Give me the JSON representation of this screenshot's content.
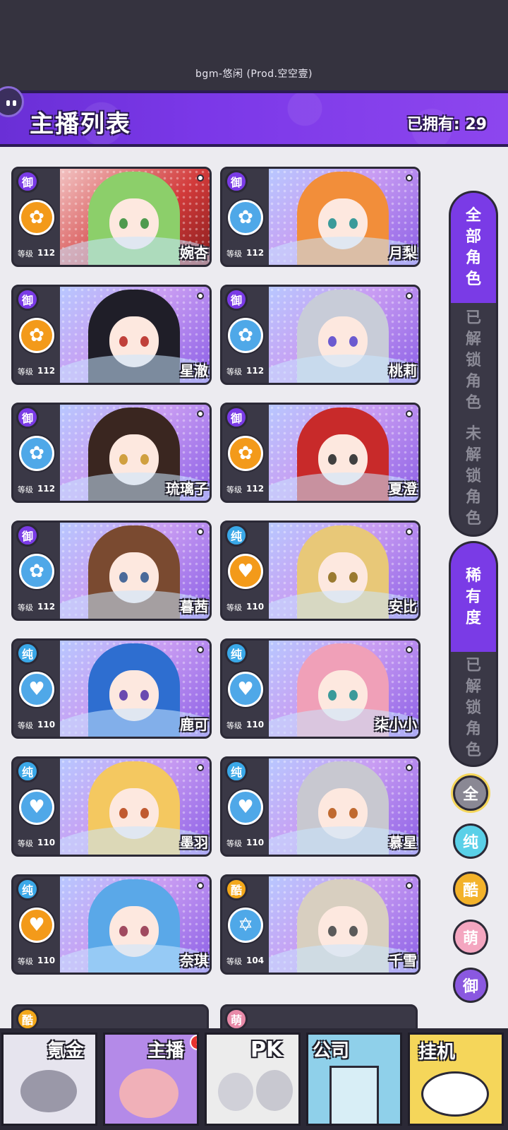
{
  "status": {
    "bgm": "bgm-悠闲 (Prod.空空壹)"
  },
  "header": {
    "title": "主播列表",
    "owned_label": "已拥有: 29"
  },
  "level_label": "等级",
  "cards": [
    {
      "name": "婉杏",
      "level": "112",
      "type": "御",
      "emblem": "rose",
      "emblem_color": "#f39a1a",
      "hair": "#8ccf6a",
      "eyes": "#4e9a4e",
      "art": "#d23a3a"
    },
    {
      "name": "月梨",
      "level": "112",
      "type": "御",
      "emblem": "rose",
      "emblem_color": "#4fa8e8",
      "hair": "#f28e3a",
      "eyes": "#3a9a9a",
      "art": "#c89cf2"
    },
    {
      "name": "星澈",
      "level": "112",
      "type": "御",
      "emblem": "rose",
      "emblem_color": "#f39a1a",
      "hair": "#1f1e28",
      "eyes": "#c0403a",
      "art": "#c89cf2"
    },
    {
      "name": "桃莉",
      "level": "112",
      "type": "御",
      "emblem": "rose",
      "emblem_color": "#4fa8e8",
      "hair": "#c8ccd8",
      "eyes": "#6b5ad0",
      "art": "#c89cf2"
    },
    {
      "name": "琉璃子",
      "level": "112",
      "type": "御",
      "emblem": "rose",
      "emblem_color": "#4fa8e8",
      "hair": "#3a2620",
      "eyes": "#d0a040",
      "art": "#c89cf2"
    },
    {
      "name": "夏澄",
      "level": "112",
      "type": "御",
      "emblem": "rose",
      "emblem_color": "#f39a1a",
      "hair": "#c82a2a",
      "eyes": "#404040",
      "art": "#c89cf2"
    },
    {
      "name": "暮茜",
      "level": "112",
      "type": "御",
      "emblem": "rose",
      "emblem_color": "#4fa8e8",
      "hair": "#7a4a30",
      "eyes": "#4a6a9a",
      "art": "#c89cf2"
    },
    {
      "name": "安比",
      "level": "110",
      "type": "纯",
      "emblem": "heart",
      "emblem_color": "#f39a1a",
      "hair": "#e8c878",
      "eyes": "#9a7a30",
      "art": "#c89cf2"
    },
    {
      "name": "鹿可",
      "level": "110",
      "type": "纯",
      "emblem": "heart",
      "emblem_color": "#4fa8e8",
      "hair": "#2e6ed0",
      "eyes": "#6a4ab0",
      "art": "#c89cf2"
    },
    {
      "name": "柒小小",
      "level": "110",
      "type": "纯",
      "emblem": "heart",
      "emblem_color": "#4fa8e8",
      "hair": "#f0a0b8",
      "eyes": "#3a9a9a",
      "art": "#c89cf2"
    },
    {
      "name": "墨羽",
      "level": "110",
      "type": "纯",
      "emblem": "heart",
      "emblem_color": "#4fa8e8",
      "hair": "#f4c860",
      "eyes": "#c05a30",
      "art": "#c89cf2"
    },
    {
      "name": "慕星",
      "level": "110",
      "type": "纯",
      "emblem": "heart",
      "emblem_color": "#4fa8e8",
      "hair": "#c8c8d0",
      "eyes": "#c06a30",
      "art": "#c89cf2"
    },
    {
      "name": "奈琪",
      "level": "110",
      "type": "纯",
      "emblem": "heart",
      "emblem_color": "#f39a1a",
      "hair": "#5aa8e8",
      "eyes": "#a04a60",
      "art": "#c89cf2"
    },
    {
      "name": "千雪",
      "level": "104",
      "type": "酷",
      "emblem": "star",
      "emblem_color": "#4fa8e8",
      "hair": "#d8cfc0",
      "eyes": "#5a5a5a",
      "art": "#c89cf2"
    }
  ],
  "peek_cards": [
    {
      "type": "酷"
    },
    {
      "type": "萌"
    }
  ],
  "type_colors": {
    "御": "#7a3be6",
    "纯": "#3aa8e8",
    "酷": "#f3a81a",
    "萌": "#e88aa8"
  },
  "filters": {
    "all_roles": "全部角色",
    "unlocked_roles": "已解锁角色",
    "locked_roles": "未解锁角色",
    "rarity": "稀有度",
    "rarity_unlocked": "已解锁角色"
  },
  "rarity_buttons": [
    {
      "label": "全",
      "color": "#8a8894",
      "text": "#ffffff"
    },
    {
      "label": "纯",
      "color": "#5ad0e8",
      "text": "#ffffff"
    },
    {
      "label": "酷",
      "color": "#f3b22a",
      "text": "#ffffff"
    },
    {
      "label": "萌",
      "color": "#f4a6c0",
      "text": "#ffffff"
    },
    {
      "label": "御",
      "color": "#8a58e0",
      "text": "#ffffff"
    }
  ],
  "nav": [
    {
      "label": "氪金",
      "bg": "#e6e4ee"
    },
    {
      "label": "主播",
      "bg": "#b48ae8"
    },
    {
      "label": "PK",
      "bg": "#ececec"
    },
    {
      "label": "公司",
      "bg": "#8fd0ea"
    },
    {
      "label": "挂机",
      "bg": "#f5d65a"
    }
  ]
}
